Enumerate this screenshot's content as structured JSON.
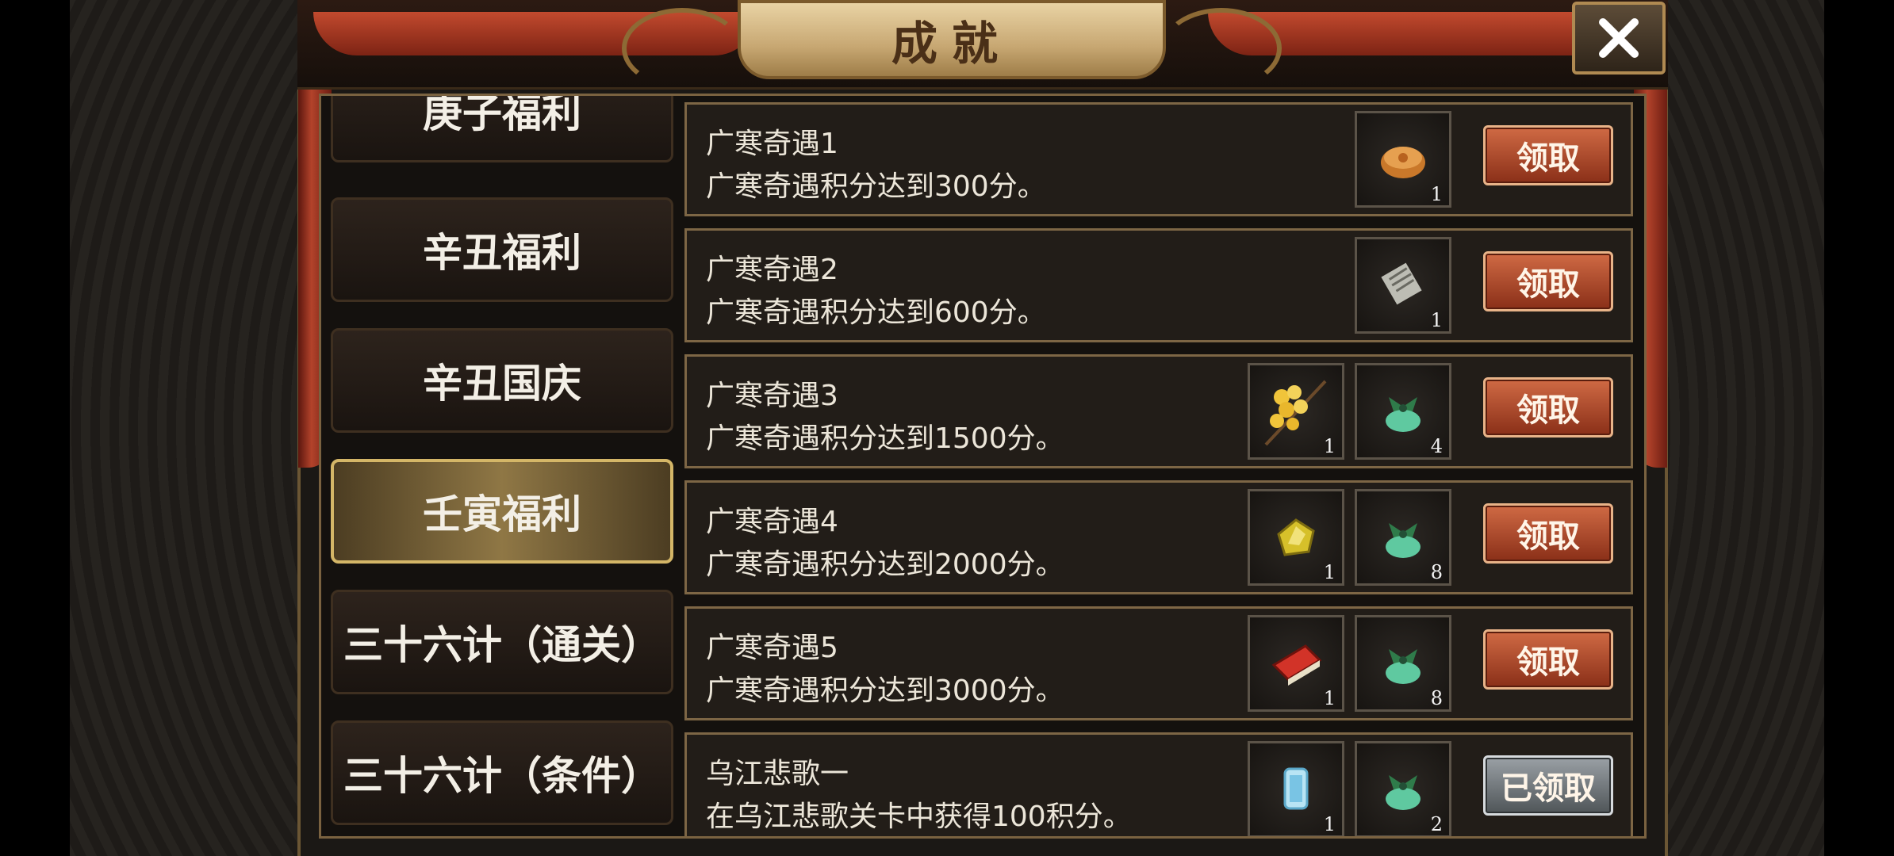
{
  "window": {
    "title": "成就",
    "close_icon": "close-icon"
  },
  "tabs": [
    {
      "label": "庚子福利",
      "active": false
    },
    {
      "label": "辛丑福利",
      "active": false
    },
    {
      "label": "辛丑国庆",
      "active": false
    },
    {
      "label": "壬寅福利",
      "active": true
    },
    {
      "label": "三十六计（通关）",
      "active": false
    },
    {
      "label": "三十六计（条件）",
      "active": false
    }
  ],
  "achievements": [
    {
      "title": "广寒奇遇1",
      "desc": "广寒奇遇积分达到300分。",
      "rewards": [
        {
          "icon": "mooncake-icon",
          "qty": "1"
        }
      ],
      "button": "领取",
      "claimed": false
    },
    {
      "title": "广寒奇遇2",
      "desc": "广寒奇遇积分达到600分。",
      "rewards": [
        {
          "icon": "scroll-icon",
          "qty": "1"
        }
      ],
      "button": "领取",
      "claimed": false
    },
    {
      "title": "广寒奇遇3",
      "desc": "广寒奇遇积分达到1500分。",
      "rewards": [
        {
          "icon": "osmanthus-icon",
          "qty": "1"
        },
        {
          "icon": "jade-pouch-icon",
          "qty": "4"
        }
      ],
      "button": "领取",
      "claimed": false
    },
    {
      "title": "广寒奇遇4",
      "desc": "广寒奇遇积分达到2000分。",
      "rewards": [
        {
          "icon": "gold-gem-icon",
          "qty": "1"
        },
        {
          "icon": "jade-pouch-icon",
          "qty": "8"
        }
      ],
      "button": "领取",
      "claimed": false
    },
    {
      "title": "广寒奇遇5",
      "desc": "广寒奇遇积分达到3000分。",
      "rewards": [
        {
          "icon": "red-book-icon",
          "qty": "1"
        },
        {
          "icon": "jade-pouch-icon",
          "qty": "8"
        }
      ],
      "button": "领取",
      "claimed": false
    },
    {
      "title": "乌江悲歌一",
      "desc": "在乌江悲歌关卡中获得100积分。",
      "rewards": [
        {
          "icon": "crystal-icon",
          "qty": "1"
        },
        {
          "icon": "jade-pouch-icon",
          "qty": "2"
        }
      ],
      "button": "已领取",
      "claimed": true
    }
  ],
  "colors": {
    "accent_gold": "#d4b667",
    "claim_red": "#b84a2a",
    "claimed_gray": "#7b8186"
  }
}
